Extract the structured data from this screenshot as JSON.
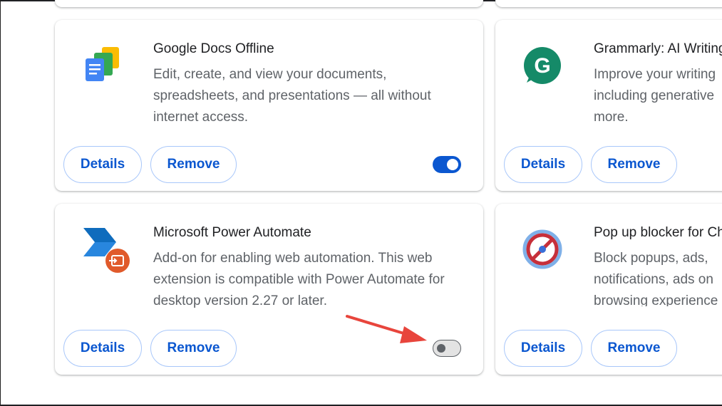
{
  "extensions": [
    {
      "title": "Google Docs Offline",
      "description": "Edit, create, and view your documents, spreadsheets, and presentations — all without internet access.",
      "details_label": "Details",
      "remove_label": "Remove",
      "enabled": true,
      "icon": "google-docs-icon"
    },
    {
      "title": "Grammarly: AI Writing",
      "description": "Improve your writing including generative more.",
      "details_label": "Details",
      "remove_label": "Remove",
      "icon": "grammarly-icon"
    },
    {
      "title": "Microsoft Power Automate",
      "description": "Add-on for enabling web automation. This web extension is compatible with Power Automate for desktop version 2.27 or later.",
      "details_label": "Details",
      "remove_label": "Remove",
      "enabled": false,
      "icon": "power-automate-icon"
    },
    {
      "title": "Pop up blocker for Chrome",
      "description": "Block popups, ads, notifications, ads on browsing experience",
      "details_label": "Details",
      "remove_label": "Remove",
      "icon": "popup-blocker-icon"
    }
  ],
  "colors": {
    "accent": "#0b57d0",
    "button_border": "#a8c7fa",
    "annotation_arrow": "#e8453c",
    "grammarly_green": "#15c39a"
  }
}
